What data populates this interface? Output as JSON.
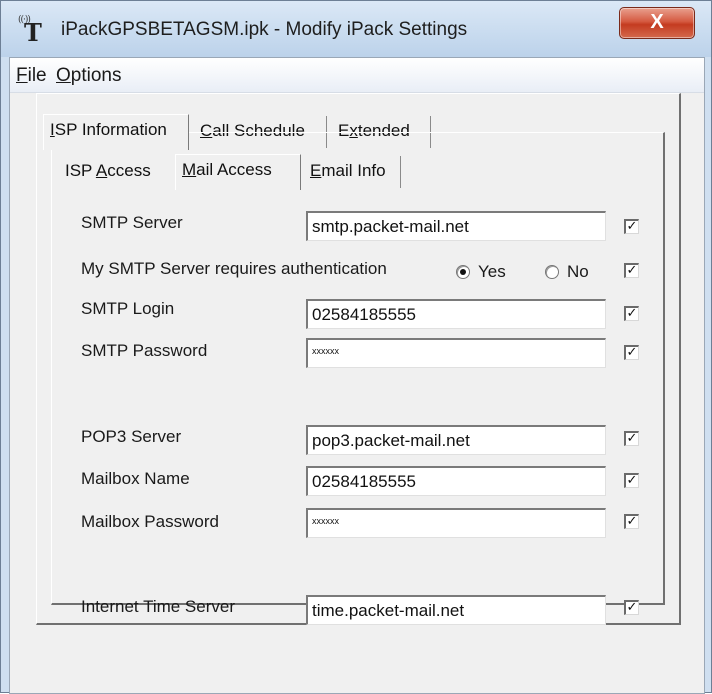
{
  "window": {
    "title": "iPackGPSBETAGSM.ipk - Modify iPack Settings",
    "close_symbol": "X"
  },
  "menu": {
    "file": {
      "mnemonic": "F",
      "rest": "ile"
    },
    "options": {
      "mnemonic": "O",
      "rest": "ptions"
    }
  },
  "main_tabs": [
    {
      "pre": "",
      "mnemonic": "I",
      "post": "SP Information",
      "active": true
    },
    {
      "pre": "",
      "mnemonic": "C",
      "post": "all Schedule",
      "active": false
    },
    {
      "pre": "E",
      "mnemonic": "x",
      "post": "tended",
      "active": false
    }
  ],
  "sub_tabs": [
    {
      "pre": "ISP ",
      "mnemonic": "A",
      "post": "ccess",
      "active": false
    },
    {
      "pre": "",
      "mnemonic": "M",
      "post": "ail Access",
      "active": true
    },
    {
      "pre": "",
      "mnemonic": "E",
      "post": "mail Info",
      "active": false
    }
  ],
  "form": {
    "smtp_server": {
      "label": "SMTP Server",
      "value": "smtp.packet-mail.net",
      "checked": true
    },
    "smtp_auth": {
      "label": "My SMTP Server requires authentication",
      "yes_label": "Yes",
      "no_label": "No",
      "selected": "Yes",
      "checked": true
    },
    "smtp_login": {
      "label": "SMTP Login",
      "value": "02584185555",
      "checked": true
    },
    "smtp_password": {
      "label": "SMTP Password",
      "value": "xxxxxx",
      "checked": true
    },
    "pop3_server": {
      "label": "POP3 Server",
      "value": "pop3.packet-mail.net",
      "checked": true
    },
    "mailbox_name": {
      "label": "Mailbox Name",
      "value": "02584185555",
      "checked": true
    },
    "mailbox_password": {
      "label": "Mailbox Password",
      "value": "xxxxxx",
      "checked": true
    },
    "time_server": {
      "label": "Internet Time Server",
      "value": "time.packet-mail.net",
      "checked": true
    }
  },
  "icons": {
    "app": "antenna-icon",
    "check_glyph": "✓"
  },
  "colors": {
    "close_button": "#c43b20",
    "titlebar": "#c8dbef",
    "dialog_face": "#f0f0f0"
  }
}
